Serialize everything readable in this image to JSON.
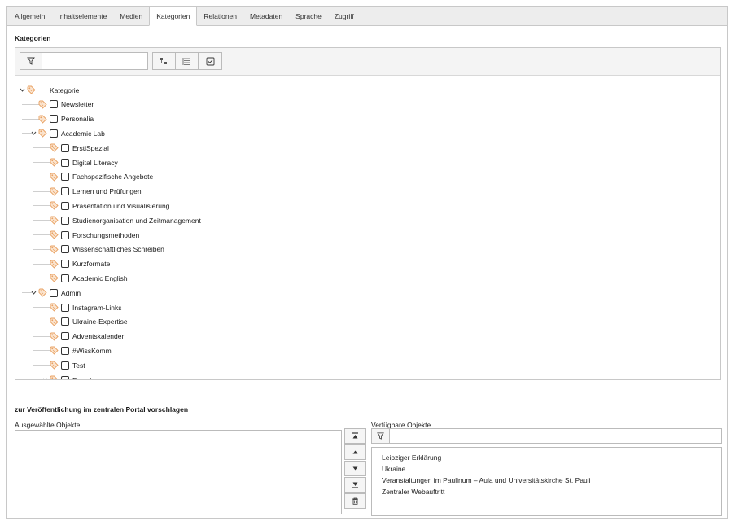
{
  "tabs": [
    "Allgemein",
    "Inhaltselemente",
    "Medien",
    "Kategorien",
    "Relationen",
    "Metadaten",
    "Sprache",
    "Zugriff"
  ],
  "active_tab": "Kategorien",
  "categories": {
    "title": "Kategorien",
    "filter_placeholder": "",
    "toolbar_icons": [
      "expand-collapse-icon",
      "list-icon",
      "checkbox-checked-icon"
    ],
    "tree": [
      {
        "label": "Kategorie",
        "level": 0,
        "expanded": true,
        "checkbox": false
      },
      {
        "label": "Newsletter",
        "level": 1,
        "expanded": false,
        "checkbox": true
      },
      {
        "label": "Personalia",
        "level": 1,
        "expanded": false,
        "checkbox": true
      },
      {
        "label": "Academic Lab",
        "level": 1,
        "expanded": true,
        "checkbox": true
      },
      {
        "label": "ErstiSpezial",
        "level": 2,
        "expanded": false,
        "checkbox": true
      },
      {
        "label": "Digital Literacy",
        "level": 2,
        "expanded": false,
        "checkbox": true
      },
      {
        "label": "Fachspezifische Angebote",
        "level": 2,
        "expanded": false,
        "checkbox": true
      },
      {
        "label": "Lernen und Prüfungen",
        "level": 2,
        "expanded": false,
        "checkbox": true
      },
      {
        "label": "Präsentation und Visualisierung",
        "level": 2,
        "expanded": false,
        "checkbox": true
      },
      {
        "label": "Studienorganisation und Zeitmanagement",
        "level": 2,
        "expanded": false,
        "checkbox": true
      },
      {
        "label": "Forschungsmethoden",
        "level": 2,
        "expanded": false,
        "checkbox": true
      },
      {
        "label": "Wissenschaftliches Schreiben",
        "level": 2,
        "expanded": false,
        "checkbox": true
      },
      {
        "label": "Kurzformate",
        "level": 2,
        "expanded": false,
        "checkbox": true
      },
      {
        "label": "Academic English",
        "level": 2,
        "expanded": false,
        "checkbox": true
      },
      {
        "label": "Admin",
        "level": 1,
        "expanded": true,
        "checkbox": true
      },
      {
        "label": "Instagram-Links",
        "level": 2,
        "expanded": false,
        "checkbox": true
      },
      {
        "label": "Ukraine-Expertise",
        "level": 2,
        "expanded": false,
        "checkbox": true
      },
      {
        "label": "Adventskalender",
        "level": 2,
        "expanded": false,
        "checkbox": true
      },
      {
        "label": "#WissKomm",
        "level": 2,
        "expanded": false,
        "checkbox": true
      },
      {
        "label": "Test",
        "level": 2,
        "expanded": false,
        "checkbox": true
      },
      {
        "label": "Forschung",
        "level": 2,
        "expanded": true,
        "checkbox": true
      }
    ]
  },
  "portal": {
    "title": "zur Veröffentlichung im zentralen Portal vorschlagen",
    "selected_label": "Ausgewählte Objekte",
    "available_label": "Verfügbare Objekte",
    "available_filter_placeholder": "",
    "move_buttons": [
      "move-to-top-icon",
      "move-up-icon",
      "move-down-icon",
      "move-to-bottom-icon",
      "trash-icon"
    ],
    "available_items": [
      "Leipziger Erklärung",
      "Ukraine",
      "Veranstaltungen im Paulinum – Aula und Universitätskirche St. Pauli",
      "Zentraler Webauftritt"
    ]
  },
  "colors": {
    "tag_icon": "#e8a060",
    "border": "#c8c8c8",
    "tab_bar": "#ededed"
  }
}
